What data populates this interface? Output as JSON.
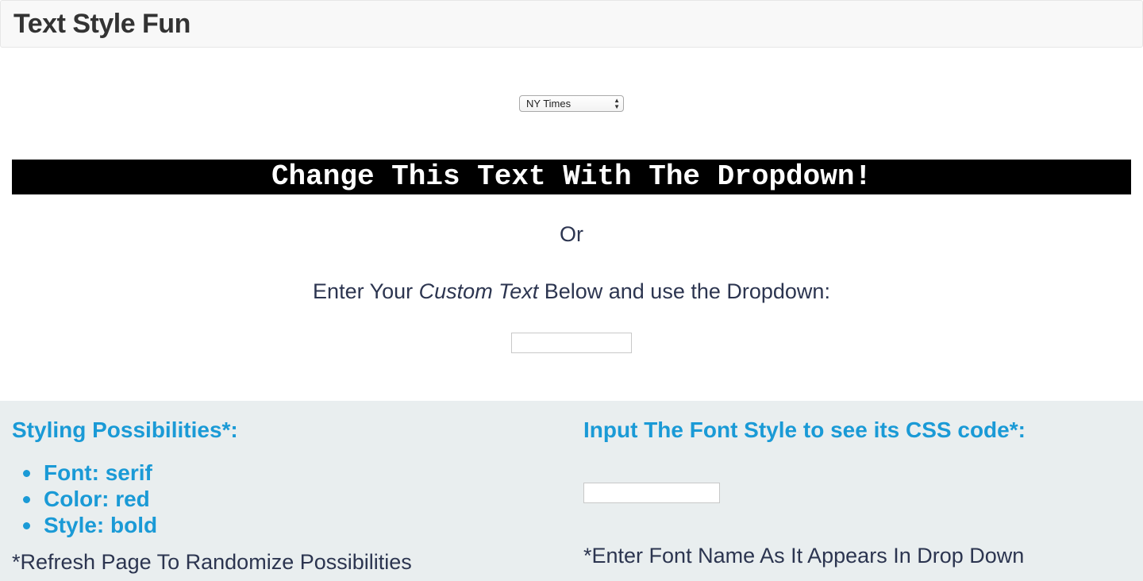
{
  "navbar": {
    "brand": "Text Style Fun"
  },
  "font_select": {
    "selected": "NY Times",
    "arrows": "▲▼"
  },
  "banner": {
    "text": "Change This Text With The Dropdown!"
  },
  "or_text": "Or",
  "enter": {
    "prefix": "Enter Your ",
    "italic": "Custom Text",
    "suffix": " Below and use the Dropdown:"
  },
  "custom_input": {
    "value": "",
    "placeholder": ""
  },
  "possibilities": {
    "heading": "Styling Possibilities*:",
    "items": [
      "Font: serif",
      "Color: red",
      "Style: bold"
    ],
    "note": "*Refresh Page To Randomize Possibilities"
  },
  "css_lookup": {
    "heading": "Input The Font Style to see its CSS code*:",
    "input_value": "",
    "note": "*Enter Font Name As It Appears In Drop Down"
  },
  "colors": {
    "accent": "#1a9ad6",
    "text": "#2c3550",
    "panel": "#e9eeef",
    "banner_bg": "#000000"
  }
}
